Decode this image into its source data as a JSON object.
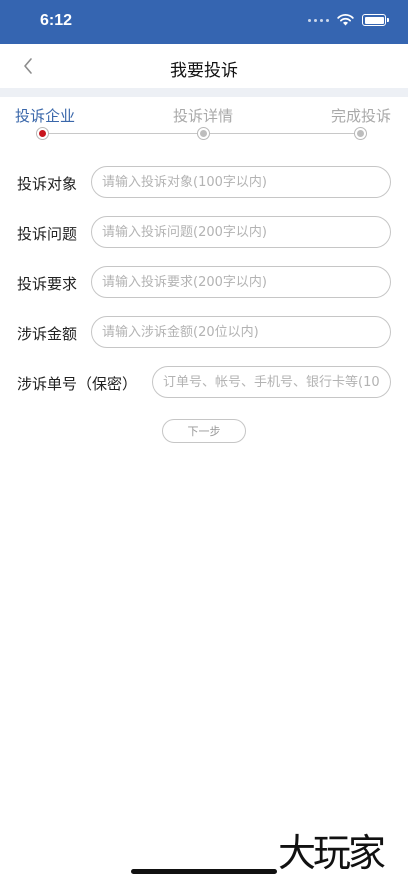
{
  "status_bar": {
    "time": "6:12"
  },
  "nav": {
    "title": "我要投诉",
    "back_icon": "chevron-left-icon"
  },
  "steps": [
    {
      "label": "投诉企业",
      "state": "active"
    },
    {
      "label": "投诉详情",
      "state": "inactive"
    },
    {
      "label": "完成投诉",
      "state": "inactive"
    }
  ],
  "form": {
    "fields": [
      {
        "label": "投诉对象",
        "placeholder": "请输入投诉对象(100字以内)",
        "value": ""
      },
      {
        "label": "投诉问题",
        "placeholder": "请输入投诉问题(200字以内)",
        "value": ""
      },
      {
        "label": "投诉要求",
        "placeholder": "请输入投诉要求(200字以内)",
        "value": ""
      },
      {
        "label": "涉诉金额",
        "placeholder": "请输入涉诉金额(20位以内)",
        "value": ""
      },
      {
        "label": "涉诉单号（保密）",
        "placeholder": "订单号、帐号、手机号、银行卡等(10...",
        "value": ""
      }
    ],
    "next_label": "下一步"
  },
  "watermark": "大玩家",
  "colors": {
    "status_bar": "#3565b1",
    "active_step": "#3a67aa",
    "active_dot": "#c8161e",
    "divider": "#edf0f5"
  }
}
